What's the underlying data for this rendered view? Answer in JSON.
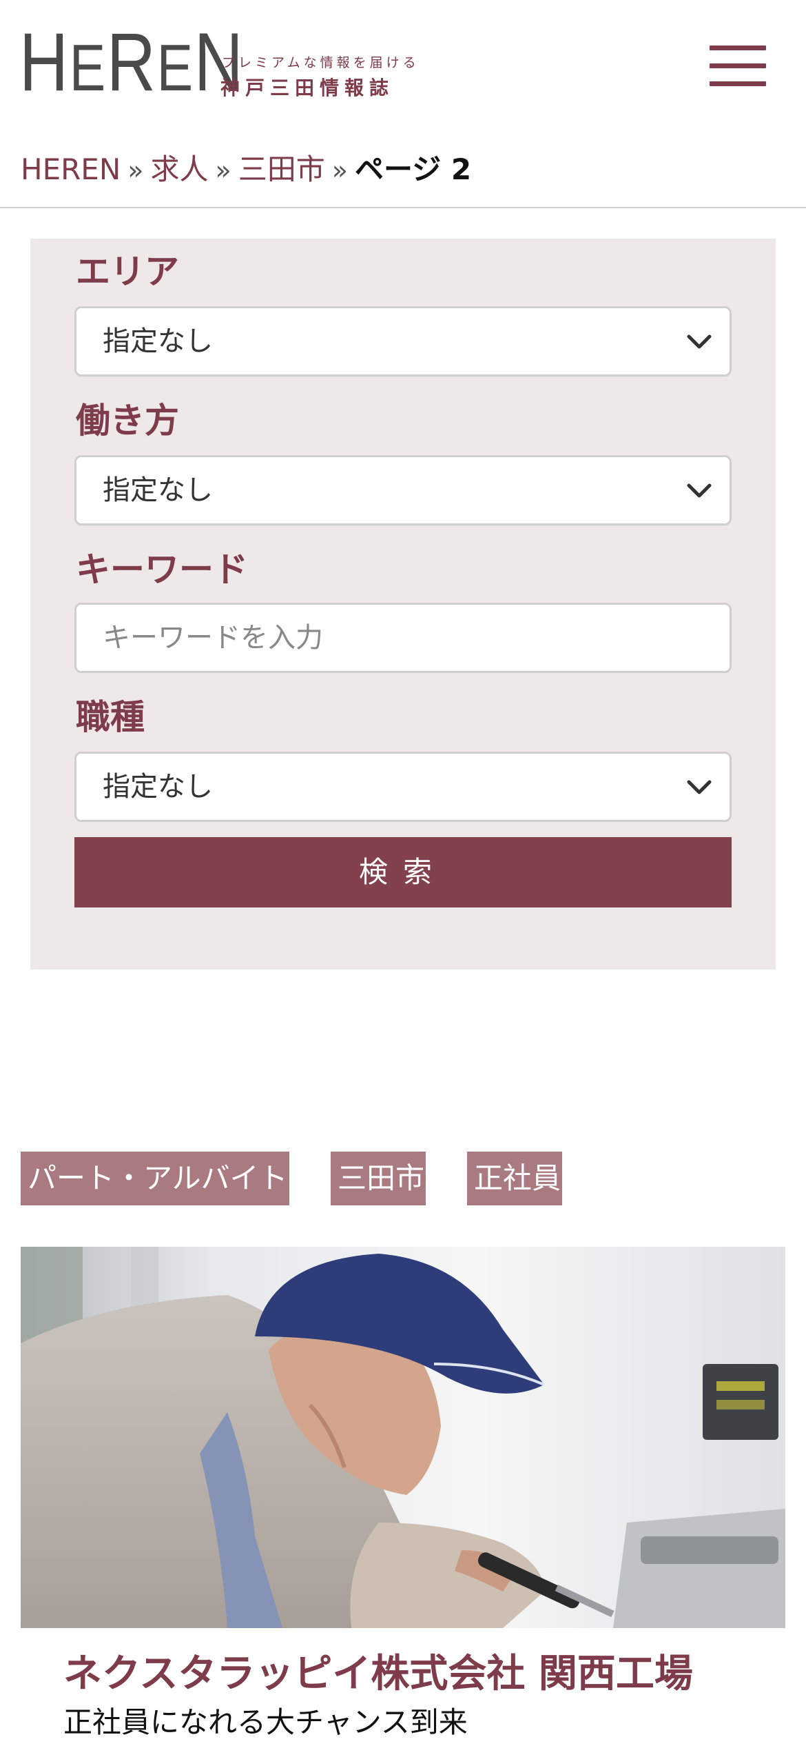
{
  "header": {
    "logo": "HeREn",
    "tagline": "プレミアムな情報を届ける",
    "subtitle": "神戸三田情報誌",
    "menu_icon": "hamburger-icon"
  },
  "breadcrumb": {
    "items": [
      "HEREN",
      "求人",
      "三田市"
    ],
    "separator": "»",
    "current": "ページ 2"
  },
  "search": {
    "area_label": "エリア",
    "area_value": "指定なし",
    "workstyle_label": "働き方",
    "workstyle_value": "指定なし",
    "keyword_label": "キーワード",
    "keyword_placeholder": "キーワードを入力",
    "jobtype_label": "職種",
    "jobtype_value": "指定なし",
    "button_label": "検索"
  },
  "job": {
    "tags": [
      "パート・アルバイト",
      "三田市",
      "正社員"
    ],
    "title": "ネクスタラッピイ株式会社 関西工場",
    "catch": "正社員になれる大チャンス到来"
  },
  "colors": {
    "brand": "#7e3b4a",
    "button": "#83404d",
    "panel_bg": "#efe8e8",
    "tag_bg": "#a97a80"
  }
}
